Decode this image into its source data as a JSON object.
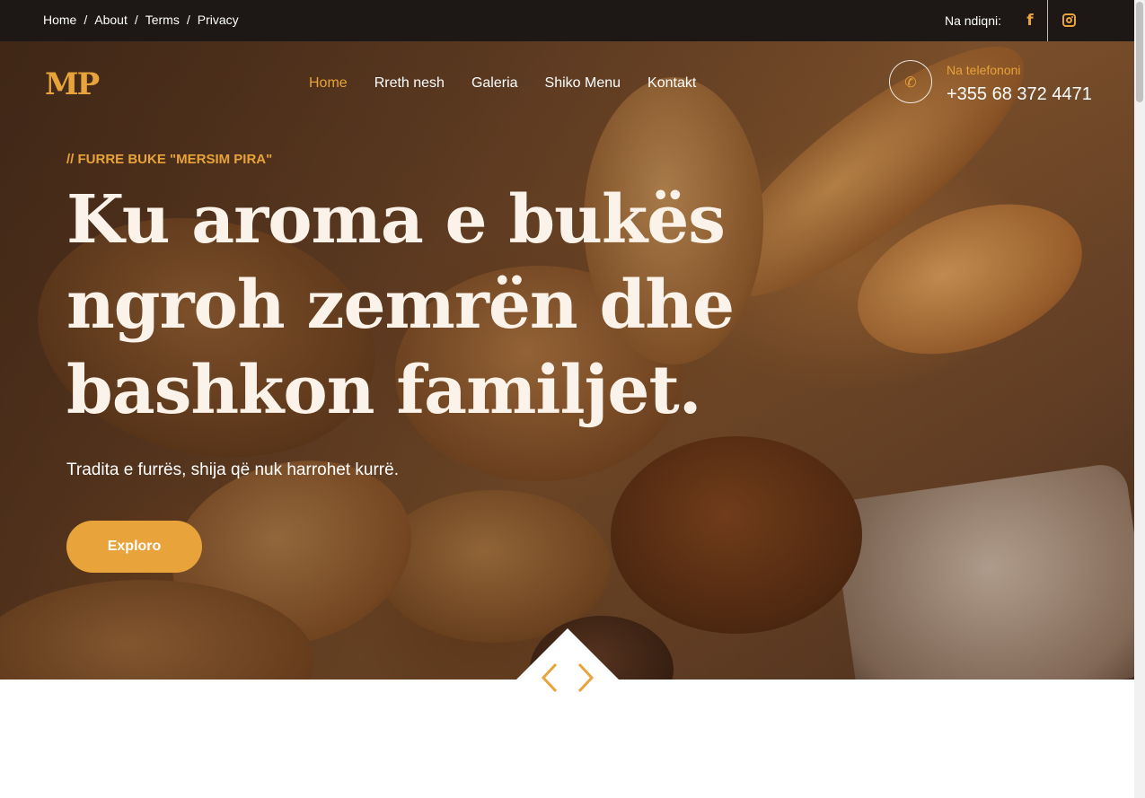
{
  "topbar": {
    "breadcrumbs": [
      {
        "label": "Home"
      },
      {
        "label": "About"
      },
      {
        "label": "Terms"
      },
      {
        "label": "Privacy"
      }
    ],
    "separator": "/",
    "follow_label": "Na ndiqni:",
    "social": [
      {
        "icon": "facebook-icon",
        "glyph": "f"
      },
      {
        "icon": "instagram-icon"
      }
    ]
  },
  "header": {
    "logo": "MP",
    "nav": [
      {
        "label": "Home",
        "active": true
      },
      {
        "label": "Rreth nesh"
      },
      {
        "label": "Galeria"
      },
      {
        "label": "Shiko Menu"
      },
      {
        "label": "Kontakt"
      }
    ],
    "phone": {
      "icon": "phone-icon",
      "glyph": "✆",
      "label": "Na telefononi",
      "number": "+355 68 372 4471"
    }
  },
  "hero": {
    "kicker": "// FURRE BUKE \"MERSIM PIRA\"",
    "headline_lines": [
      "Ku aroma e bukës",
      "ngroh zemrën dhe",
      "bashkon familjet."
    ],
    "subtitle": "Tradita e furrës, shija që nuk harrohet kurrë.",
    "button_label": "Exploro",
    "slider_arrows": [
      "chevron-left-icon",
      "chevron-right-icon"
    ]
  },
  "colors": {
    "accent": "#e8a33a",
    "topbar_bg": "#1d1816",
    "text_light": "#ffffff",
    "headline": "#fbf3ea"
  }
}
